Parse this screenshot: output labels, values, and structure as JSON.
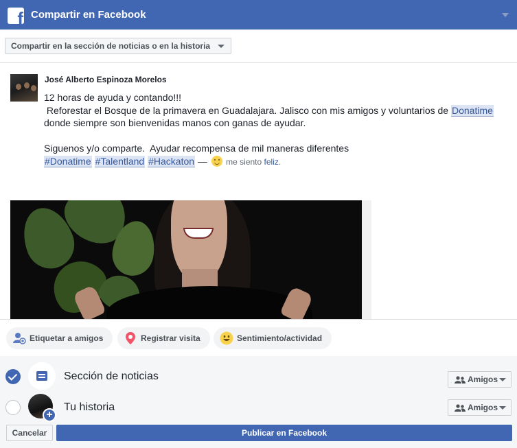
{
  "header": {
    "title": "Compartir en Facebook",
    "logo_icon": "facebook-f-icon"
  },
  "destination": {
    "selected": "Compartir en la sección de noticias o en la historia"
  },
  "post": {
    "author": "José Alberto Espinoza Morelos",
    "line1": "12 horas de ayuda y contando!!!",
    "line2_pre": " Reforestar el Bosque de la primavera en Guadalajara. Jalisco con mis amigos y voluntarios de ",
    "line2_link": "Donatime",
    "line3": "donde siempre son bienvenidas manos con ganas de ayudar.",
    "line5": "Siguenos y/o comparte.  Ayudar recompensa de mil maneras diferentes",
    "hashtags": [
      "#Donatime",
      "#Talentland",
      "#Hackaton"
    ],
    "feeling_sep": " — ",
    "feeling_pre": " me siento ",
    "feeling_link": "feliz",
    "feeling_post": "."
  },
  "actions": [
    {
      "label": "Etiquetar a amigos",
      "icon": "tag-friends-icon"
    },
    {
      "label": "Registrar visita",
      "icon": "location-pin-icon"
    },
    {
      "label": "Sentimiento/actividad",
      "icon": "smiley-icon"
    }
  ],
  "audience": {
    "news_feed": {
      "label": "Sección de noticias",
      "checked": true,
      "privacy": "Amigos"
    },
    "story": {
      "label": "Tu historia",
      "checked": false,
      "privacy": "Amigos"
    }
  },
  "buttons": {
    "cancel": "Cancelar",
    "publish": "Publicar en Facebook"
  },
  "colors": {
    "brand": "#4267b2",
    "link": "#365899",
    "hashtag_bg": "#dce4f4"
  }
}
